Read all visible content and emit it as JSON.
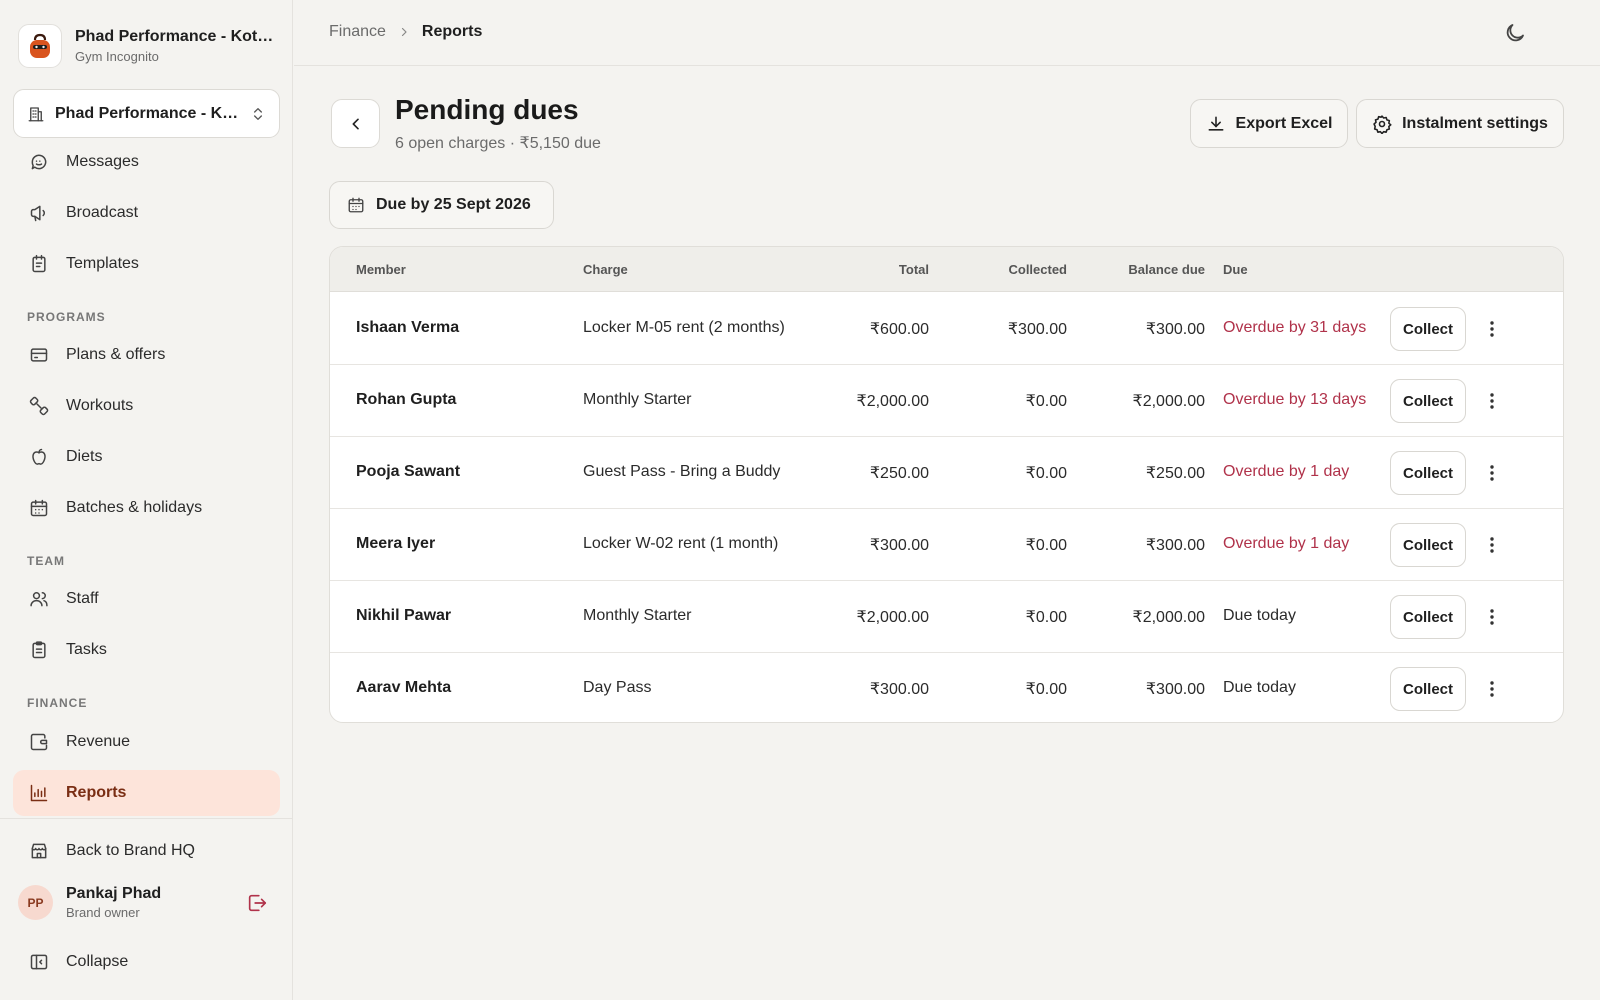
{
  "brand": {
    "name": "Phad Performance - Kothrud",
    "subtitle": "Gym Incognito"
  },
  "location": {
    "label": "Phad Performance - Kothrud"
  },
  "nav": {
    "messages": "Messages",
    "broadcast": "Broadcast",
    "templates": "Templates",
    "programs_label": "PROGRAMS",
    "plans": "Plans & offers",
    "workouts": "Workouts",
    "diets": "Diets",
    "batches": "Batches & holidays",
    "team_label": "TEAM",
    "staff": "Staff",
    "tasks": "Tasks",
    "finance_label": "FINANCE",
    "revenue": "Revenue",
    "reports": "Reports",
    "back_hq": "Back to Brand HQ",
    "collapse": "Collapse"
  },
  "user": {
    "initials": "PP",
    "name": "Pankaj Phad",
    "role": "Brand owner"
  },
  "breadcrumb": {
    "parent": "Finance",
    "current": "Reports"
  },
  "page": {
    "title": "Pending dues",
    "subtitle": "6 open charges · ₹5,150 due",
    "export_label": "Export Excel",
    "settings_label": "Instalment settings",
    "filter_label": "Due by 25 Sept 2026"
  },
  "table": {
    "headers": {
      "member": "Member",
      "charge": "Charge",
      "total": "Total",
      "collected": "Collected",
      "balance": "Balance due",
      "due": "Due"
    },
    "collect_label": "Collect",
    "rows": [
      {
        "member": "Ishaan Verma",
        "charge": "Locker M-05 rent (2 months)",
        "total": "₹600.00",
        "collected": "₹300.00",
        "balance": "₹300.00",
        "due": "Overdue by 31 days"
      },
      {
        "member": "Rohan Gupta",
        "charge": "Monthly Starter",
        "total": "₹2,000.00",
        "collected": "₹0.00",
        "balance": "₹2,000.00",
        "due": "Overdue by 13 days"
      },
      {
        "member": "Pooja Sawant",
        "charge": "Guest Pass - Bring a Buddy",
        "total": "₹250.00",
        "collected": "₹0.00",
        "balance": "₹250.00",
        "due": "Overdue by 1 day"
      },
      {
        "member": "Meera Iyer",
        "charge": "Locker W-02 rent (1 month)",
        "total": "₹300.00",
        "collected": "₹0.00",
        "balance": "₹300.00",
        "due": "Overdue by 1 day"
      },
      {
        "member": "Nikhil Pawar",
        "charge": "Monthly Starter",
        "total": "₹2,000.00",
        "collected": "₹0.00",
        "balance": "₹2,000.00",
        "due": "Due today"
      },
      {
        "member": "Aarav Mehta",
        "charge": "Day Pass",
        "total": "₹300.00",
        "collected": "₹0.00",
        "balance": "₹300.00",
        "due": "Due today"
      }
    ]
  },
  "colors": {
    "accent": "#fde4da",
    "overdue": "#b0324a",
    "background": "#f4f3f0"
  }
}
